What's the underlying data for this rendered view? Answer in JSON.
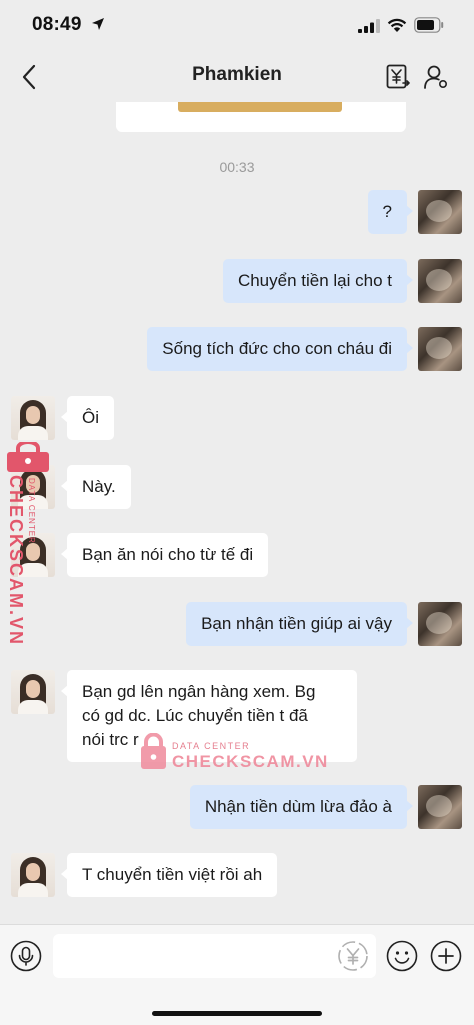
{
  "status_bar": {
    "time": "08:49"
  },
  "nav": {
    "title": "Phamkien"
  },
  "chat": {
    "timestamp": "00:33",
    "messages": [
      {
        "side": "out",
        "text": "?"
      },
      {
        "side": "out",
        "text": "Chuyển tiền lại cho t"
      },
      {
        "side": "out",
        "text": "Sống tích đức cho con cháu đi"
      },
      {
        "side": "in",
        "text": "Ôi"
      },
      {
        "side": "in",
        "text": "Này."
      },
      {
        "side": "in",
        "text": "Bạn ăn nói cho từ tế đi"
      },
      {
        "side": "out",
        "text": "Bạn nhận tiền giúp ai vậy"
      },
      {
        "side": "in",
        "text": "Bạn gd lên ngân hàng xem. Bg\ncó gd dc. Lúc chuyển tiền t đã\nnói trc r"
      },
      {
        "side": "out",
        "text": "Nhận tiền dùm lừa đảo à"
      },
      {
        "side": "in",
        "text": "T chuyển tiền việt rồi ah"
      }
    ]
  },
  "watermark": {
    "small": "DATA CENTER",
    "brand": "CHECKSCAM.VN"
  },
  "colors": {
    "background": "#ededed",
    "outgoing_bubble": "#d7e6fb",
    "incoming_bubble": "#ffffff",
    "watermark": "#e2566b"
  },
  "icons": {
    "back": "chevron-left-icon",
    "transfer": "yen-transfer-icon",
    "profile": "user-settings-icon",
    "voice": "microphone-icon",
    "currency": "yen-icon",
    "emoji": "smiley-icon",
    "plus": "plus-icon"
  }
}
